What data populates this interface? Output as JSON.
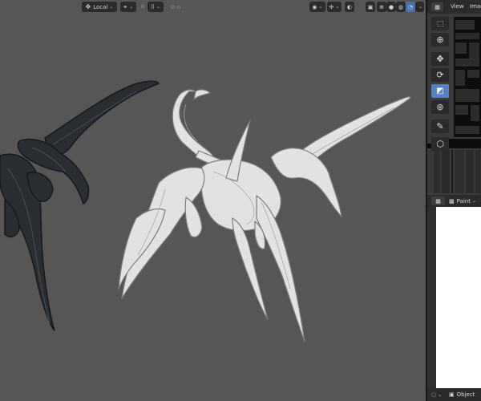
{
  "viewport": {
    "header": {
      "transform_orientation": "Local",
      "proportional_icon": "proportional-falloff-icon"
    }
  },
  "right_header": {
    "view_menu": "View",
    "image_menu": "Imag"
  },
  "lower_header": {
    "mode_label": "Paint"
  },
  "footer": {
    "object_label": "Object"
  },
  "colors": {
    "viewport_bg": "#565656",
    "active_tool": "#5680c2",
    "header_bg": "#2b2b2b",
    "panel_bg": "#1d1d1d"
  }
}
